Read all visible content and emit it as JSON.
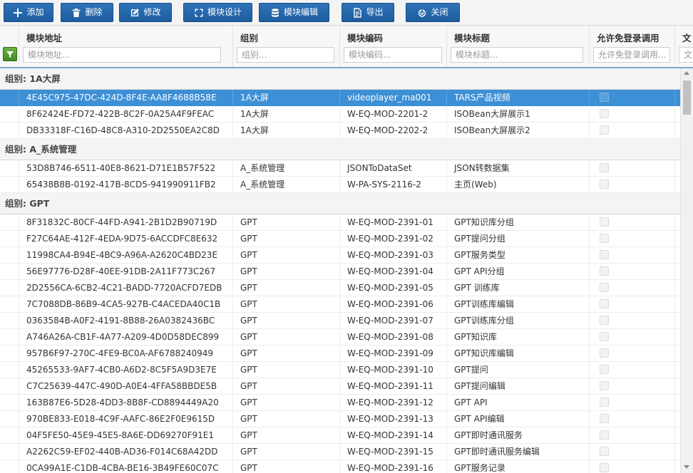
{
  "toolbar": {
    "add": "添加",
    "delete": "删除",
    "edit": "修改",
    "module_design": "模块设计",
    "module_edit": "模块编辑",
    "export": "导出",
    "close": "关闭"
  },
  "columns": [
    {
      "title": "模块地址",
      "placeholder": "模块地址..."
    },
    {
      "title": "组别",
      "placeholder": "组别..."
    },
    {
      "title": "模块编码",
      "placeholder": "模块编码..."
    },
    {
      "title": "模块标题",
      "placeholder": "模块标题..."
    },
    {
      "title": "允许免登录调用",
      "placeholder": "允许免登录调用..."
    },
    {
      "title": "文",
      "placeholder": "文"
    }
  ],
  "groups": [
    {
      "label": "组别: 1A大屏",
      "rows": [
        {
          "address": "4E45C975-47DC-424D-8F4E-AA8F4688B58E",
          "group": "1A大屏",
          "code": "videoplayer_ma001",
          "title": "TARS产品视频",
          "selected": true
        },
        {
          "address": "8F62424E-FD72-422B-8C2F-0A25A4F9FEAC",
          "group": "1A大屏",
          "code": "W-EQ-MOD-2201-2",
          "title": "ISOBean大屏展示1"
        },
        {
          "address": "DB33318F-C16D-48C8-A310-2D2550EA2C8D",
          "group": "1A大屏",
          "code": "W-EQ-MOD-2202-2",
          "title": "ISOBean大屏展示2"
        }
      ]
    },
    {
      "label": "组别: A_系统管理",
      "rows": [
        {
          "address": "53D8B746-6511-40E8-8621-D71E1B57F522",
          "group": "A_系统管理",
          "code": "JSONToDataSet",
          "title": "JSON转数据集"
        },
        {
          "address": "65438B8B-0192-417B-8CD5-941990911FB2",
          "group": "A_系统管理",
          "code": "W-PA-SYS-2116-2",
          "title": "主页(Web)"
        }
      ]
    },
    {
      "label": "组别: GPT",
      "rows": [
        {
          "address": "8F31832C-80CF-44FD-A941-2B1D2B90719D",
          "group": "GPT",
          "code": "W-EQ-MOD-2391-01",
          "title": "GPT知识库分组"
        },
        {
          "address": "F27C64AE-412F-4EDA-9D75-6ACCDFC8E632",
          "group": "GPT",
          "code": "W-EQ-MOD-2391-02",
          "title": "GPT提问分组"
        },
        {
          "address": "11998CA4-B94E-4BC9-A96A-A2620C4BD23E",
          "group": "GPT",
          "code": "W-EQ-MOD-2391-03",
          "title": "GPT服务类型"
        },
        {
          "address": "56E97776-D28F-40EE-91DB-2A11F773C267",
          "group": "GPT",
          "code": "W-EQ-MOD-2391-04",
          "title": "GPT API分组"
        },
        {
          "address": "2D2556CA-6CB2-4C21-BADD-7720ACFD7EDB",
          "group": "GPT",
          "code": "W-EQ-MOD-2391-05",
          "title": "GPT 训练库"
        },
        {
          "address": "7C7088DB-86B9-4CA5-927B-C4ACEDA40C1B",
          "group": "GPT",
          "code": "W-EQ-MOD-2391-06",
          "title": "GPT训练库编辑"
        },
        {
          "address": "0363584B-A0F2-4191-8B88-26A0382436BC",
          "group": "GPT",
          "code": "W-EQ-MOD-2391-07",
          "title": "GPT训练库分组"
        },
        {
          "address": "A746A26A-CB1F-4A77-A209-4D0D58DEC899",
          "group": "GPT",
          "code": "W-EQ-MOD-2391-08",
          "title": "GPT知识库"
        },
        {
          "address": "957B6F97-270C-4FE9-BC0A-AF6788240949",
          "group": "GPT",
          "code": "W-EQ-MOD-2391-09",
          "title": "GPT知识库编辑"
        },
        {
          "address": "45265533-9AF7-4CB0-A6D2-8C5F5A9D3E7E",
          "group": "GPT",
          "code": "W-EQ-MOD-2391-10",
          "title": "GPT提问"
        },
        {
          "address": "C7C25639-447C-490D-A0E4-4FFA58BBDE5B",
          "group": "GPT",
          "code": "W-EQ-MOD-2391-11",
          "title": "GPT提问编辑"
        },
        {
          "address": "163B87E6-5D28-4DD3-8B8F-CD8894449A20",
          "group": "GPT",
          "code": "W-EQ-MOD-2391-12",
          "title": "GPT API"
        },
        {
          "address": "970BE833-E018-4C9F-AAFC-86E2F0E9615D",
          "group": "GPT",
          "code": "W-EQ-MOD-2391-13",
          "title": "GPT API编辑"
        },
        {
          "address": "04F5FE50-45E9-45E5-8A6E-DD69270F91E1",
          "group": "GPT",
          "code": "W-EQ-MOD-2391-14",
          "title": "GPT即时通讯服务"
        },
        {
          "address": "A2262C59-EF02-440B-AD36-F014C68A42DD",
          "group": "GPT",
          "code": "W-EQ-MOD-2391-15",
          "title": "GPT即时通讯服务编辑"
        },
        {
          "address": "0CA99A1E-C1DB-4CBA-BE16-3B49FE60C07C",
          "group": "GPT",
          "code": "W-EQ-MOD-2391-16",
          "title": "GPT服务记录"
        }
      ]
    }
  ],
  "colors": {
    "toolbar_button": "#2369ad",
    "selected_row": "#3d8fd6"
  }
}
